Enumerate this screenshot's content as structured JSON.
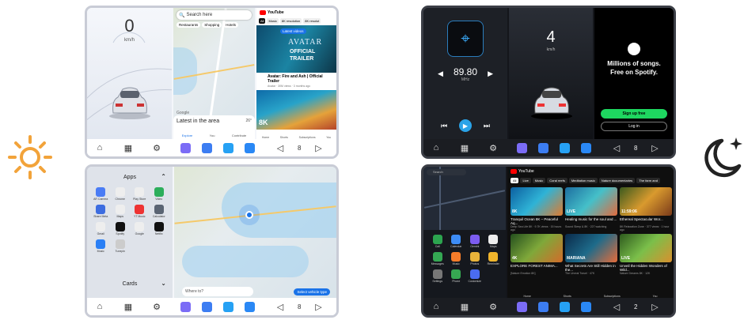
{
  "light_top": {
    "speed": "0",
    "speed_unit": "km/h",
    "search_placeholder": "Search here",
    "map_chips": [
      "Restaurants",
      "Shopping",
      "Hotels"
    ],
    "latest_area": "Latest in the area",
    "temp": "26°",
    "map_nav": [
      "Explore",
      "You",
      "Contribute"
    ],
    "yt_brand": "YouTube",
    "yt_chips": [
      "All",
      "Music",
      "8K resolution",
      "8K resolut"
    ],
    "latest_videos": "Latest videos",
    "trailer_title_1": "AVATAR",
    "trailer_title_2": "OFFICIAL",
    "trailer_title_3": "TRAILER",
    "video_title": "Avatar: Fire and Ash | Official Trailer",
    "video_meta": "Avatar · 30M views · 3 months ago",
    "badge": "8K",
    "yt_nav": [
      "Home",
      "Shorts",
      "Subscriptions",
      "You"
    ],
    "volume": "8",
    "google": "Google"
  },
  "light_bottom": {
    "apps_title": "Apps",
    "apps": [
      "AR Camera",
      "Chrome",
      "Play Store",
      "Video",
      "Share Meta",
      "Maps",
      "YT Music",
      "Calculator",
      "Gmail",
      "Spotify",
      "Google",
      "Netflix",
      "Music",
      "Tunepin"
    ],
    "cards_title": "Cards",
    "where_to": "Where to?",
    "vehicle_type": "Select vehicle type",
    "volume": "8"
  },
  "dark_top": {
    "freq": "89.80",
    "freq_unit": "MHz",
    "speed": "4",
    "speed_unit": "km/h",
    "spotify_line1": "Millions of songs.",
    "spotify_line2": "Free on Spotify.",
    "signup": "Sign up free",
    "login": "Log in",
    "volume": "8"
  },
  "dark_bottom": {
    "yt_brand": "YouTube",
    "chips": [
      "All",
      "Live",
      "Music",
      "Coral reefs",
      "Meditation music",
      "Nature documentaries",
      "The farm and"
    ],
    "search": "Search",
    "apps": [
      "Call",
      "Calendar",
      "Gemini",
      "Maps",
      "Messages",
      "Music",
      "Photos",
      "Reminder",
      "Settings",
      "Phone",
      "Customize"
    ],
    "videos": [
      {
        "title": "Tranquil Ocean 8K – Peaceful Aq...",
        "meta": "Deep Sea Life 8K · 9.7K views · 15 hours ago",
        "badge": "8K"
      },
      {
        "title": "Healing music for the soul and ...",
        "meta": "Sound Sleep & 8K · 227 watching",
        "badge": "LIVE"
      },
      {
        "title": "Ethereal Spectacular Wor...",
        "meta": "8K Relaxation Zone · 377 views · 1 hour ago",
        "badge": "11:59:06"
      },
      {
        "title": "EXPLORE FOREST ANIMA...",
        "meta": "[Nature Emotion 8K]",
        "badge": "4K"
      },
      {
        "title": "What Secrets Are Still Hidden in the...",
        "meta": "The Unreal Travel · 47K",
        "badge": "MARIANA"
      },
      {
        "title": "Unveil the Hidden Wonders of Wild...",
        "meta": "Nature Dreams 8K · 12K",
        "badge": "LIVE"
      }
    ],
    "nav": [
      "Home",
      "Shorts",
      "Subscriptions",
      "You"
    ],
    "volume": "2"
  }
}
